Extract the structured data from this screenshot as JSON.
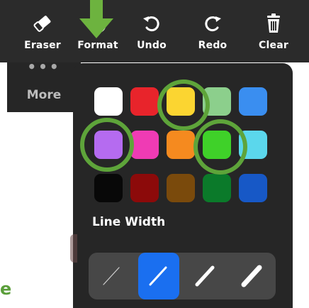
{
  "toolbar": {
    "buttons": [
      {
        "label": "Eraser",
        "icon": "eraser-icon"
      },
      {
        "label": "Format",
        "icon": "format-icon"
      },
      {
        "label": "Undo",
        "icon": "undo-icon"
      },
      {
        "label": "Redo",
        "icon": "redo-icon"
      },
      {
        "label": "Clear",
        "icon": "trash-icon"
      }
    ],
    "arrow_color": "#6db33f"
  },
  "more": {
    "dots": "•••",
    "label": "More"
  },
  "format_panel": {
    "colors": [
      "#ffffff",
      "#e8242b",
      "#fbd531",
      "#8ccf8c",
      "#3a8ef0",
      "#b56bf0",
      "#ef3bb4",
      "#f58a1f",
      "#3fd129",
      "#5bd7ec",
      "#080808",
      "#8c0a0a",
      "#7a4a0c",
      "#0b7a2a",
      "#1758c6"
    ],
    "highlighted_colors": [
      "#fbd531",
      "#b56bf0",
      "#3fd129"
    ],
    "highlight_ring_color": "#5ea43a",
    "line_width": {
      "title": "Line Width",
      "options": [
        "thinnest",
        "thin",
        "medium",
        "thick"
      ],
      "selected": "thin"
    }
  },
  "background_fragment": {
    "text": "e"
  }
}
